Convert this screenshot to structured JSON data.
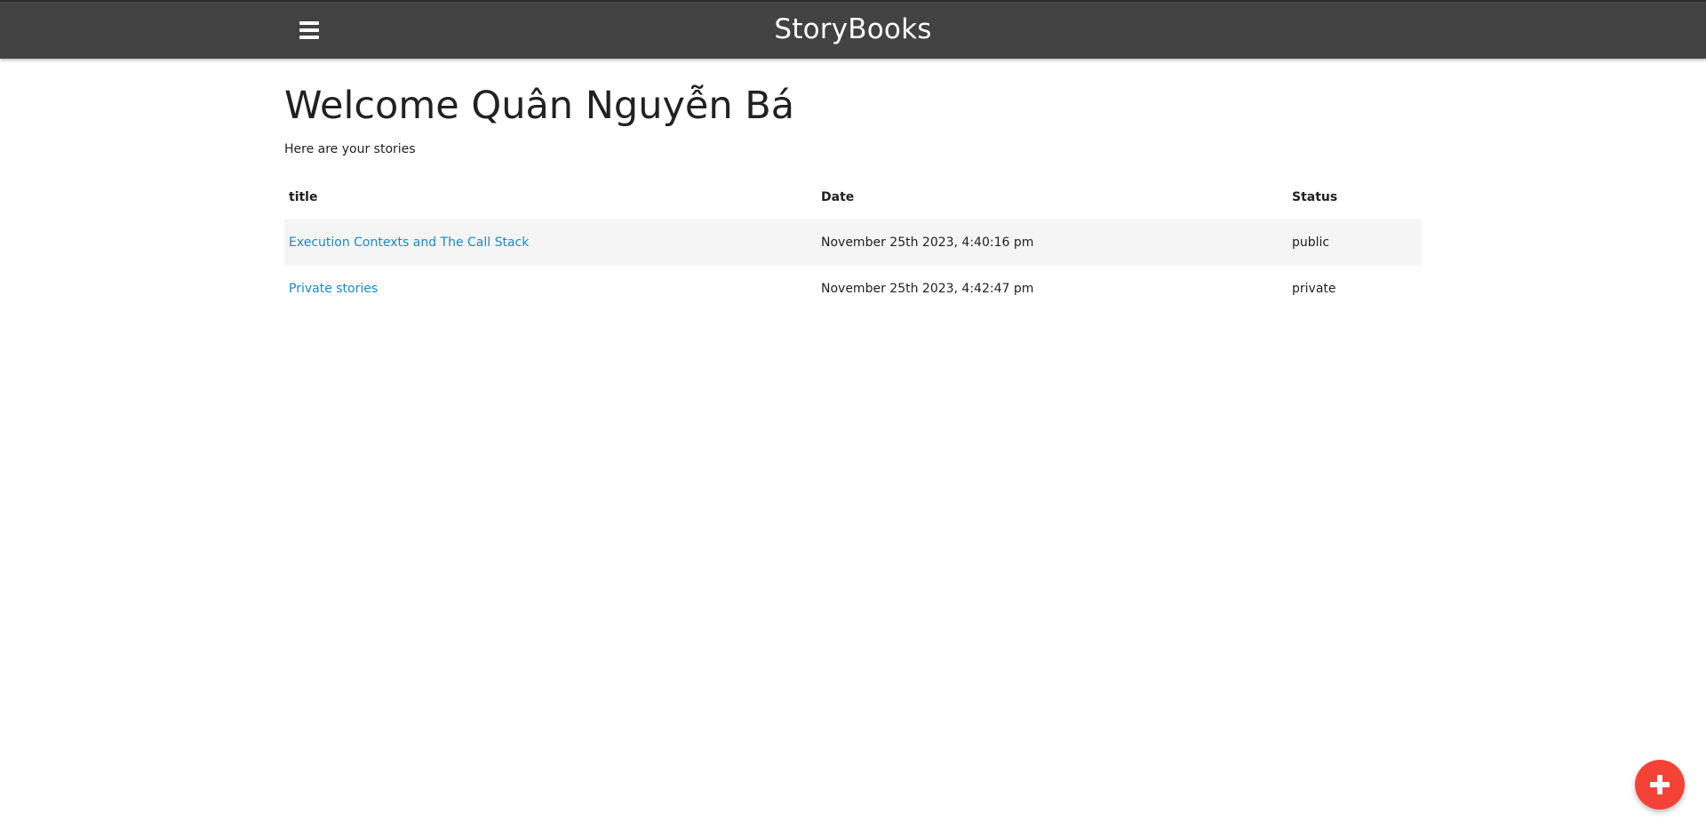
{
  "navbar": {
    "brand": "StoryBooks",
    "menu_icon": "hamburger-menu-icon",
    "background_color": "#424242"
  },
  "dashboard": {
    "welcome": "Welcome Quân Nguyễn Bá",
    "subtitle": "Here are your stories",
    "table": {
      "headers": [
        "title",
        "Date",
        "Status"
      ],
      "rows": [
        {
          "title": "Execution Contexts and The Call Stack",
          "date": "November 25th 2023, 4:40:16 pm",
          "status": "public"
        },
        {
          "title": "Private stories",
          "date": "November 25th 2023, 4:42:47 pm",
          "status": "private"
        }
      ]
    }
  },
  "fab": {
    "icon": "plus-icon",
    "color": "#f44336"
  },
  "colors": {
    "link": "#1e88c7",
    "row_stripe": "#f5f5f5"
  }
}
